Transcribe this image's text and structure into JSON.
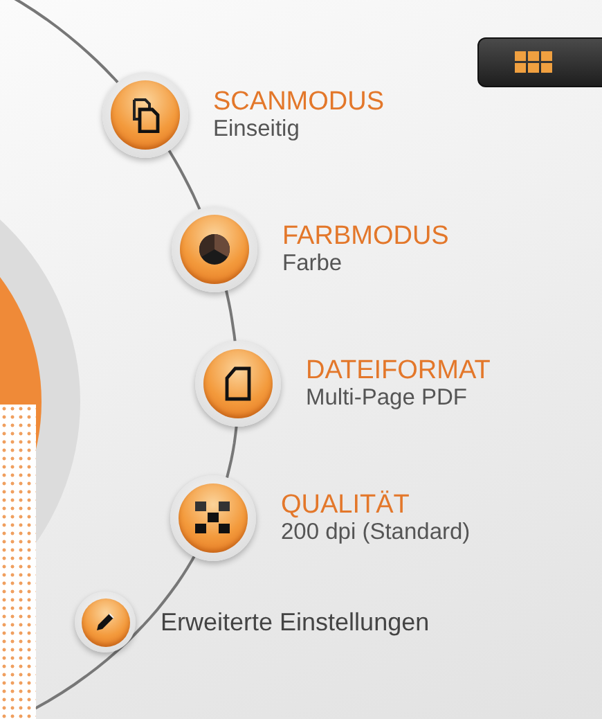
{
  "settings": [
    {
      "title": "SCANMODUS",
      "value": "Einseitig"
    },
    {
      "title": "FARBMODUS",
      "value": "Farbe"
    },
    {
      "title": "DATEIFORMAT",
      "value": "Multi-Page PDF"
    },
    {
      "title": "QUALITÄT",
      "value": "200 dpi (Standard)"
    }
  ],
  "advanced": {
    "label": "Erweiterte Einstellungen"
  }
}
